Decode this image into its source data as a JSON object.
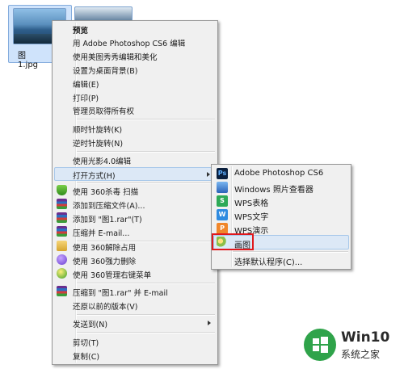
{
  "desktop": {
    "files": [
      {
        "label": "图1.jpg",
        "selected": true
      },
      {
        "label": "",
        "selected": false
      }
    ]
  },
  "context_menu": {
    "items": [
      {
        "label": "预览",
        "bold": true
      },
      {
        "label": "用 Adobe Photoshop CS6 编辑"
      },
      {
        "label": "使用美图秀秀编辑和美化"
      },
      {
        "label": "设置为桌面背景(B)"
      },
      {
        "label": "编辑(E)"
      },
      {
        "label": "打印(P)"
      },
      {
        "label": "管理员取得所有权"
      },
      {
        "label": "顺时针旋转(K)"
      },
      {
        "label": "逆时针旋转(N)"
      },
      {
        "label": "使用光影4.0编辑"
      },
      {
        "label": "打开方式(H)",
        "submenu": true
      },
      {
        "label": "使用 360杀毒 扫描",
        "icon": "360-shield-icon"
      },
      {
        "label": "添加到压缩文件(A)...",
        "icon": "winrar-icon"
      },
      {
        "label": "添加到 \"图1.rar\"(T)",
        "icon": "winrar-icon"
      },
      {
        "label": "压缩并 E-mail...",
        "icon": "winrar-icon"
      },
      {
        "label": "使用 360解除占用",
        "icon": "360-unlock-icon"
      },
      {
        "label": "使用 360强力删除",
        "icon": "360-delete-icon"
      },
      {
        "label": "使用 360管理右键菜单",
        "icon": "360-menu-manager-icon"
      },
      {
        "label": "压缩到 \"图1.rar\" 并 E-mail",
        "icon": "winrar-icon"
      },
      {
        "label": "还原以前的版本(V)"
      },
      {
        "label": "发送到(N)",
        "submenu": true
      },
      {
        "label": "剪切(T)"
      },
      {
        "label": "复制(C)"
      }
    ]
  },
  "open_with_menu": {
    "items": [
      {
        "label": "Adobe Photoshop CS6",
        "icon_text": "Ps",
        "color": "#0a1f3e"
      },
      {
        "label": "Windows 照片查看器",
        "icon_text": "",
        "color": "#3a7bd5"
      },
      {
        "label": "WPS表格",
        "icon_text": "S",
        "color": "#2eaa57"
      },
      {
        "label": "WPS文字",
        "icon_text": "W",
        "color": "#2f8be0"
      },
      {
        "label": "WPS演示",
        "icon_text": "P",
        "color": "#f0862a"
      },
      {
        "label": "画图",
        "icon_text": "",
        "color": "#8bbf4a",
        "highlighted": true
      },
      {
        "label": "选择默认程序(C)...",
        "icon_text": "",
        "color": ""
      }
    ]
  },
  "watermark": {
    "name": "Win10",
    "subtitle": "系统之家"
  }
}
